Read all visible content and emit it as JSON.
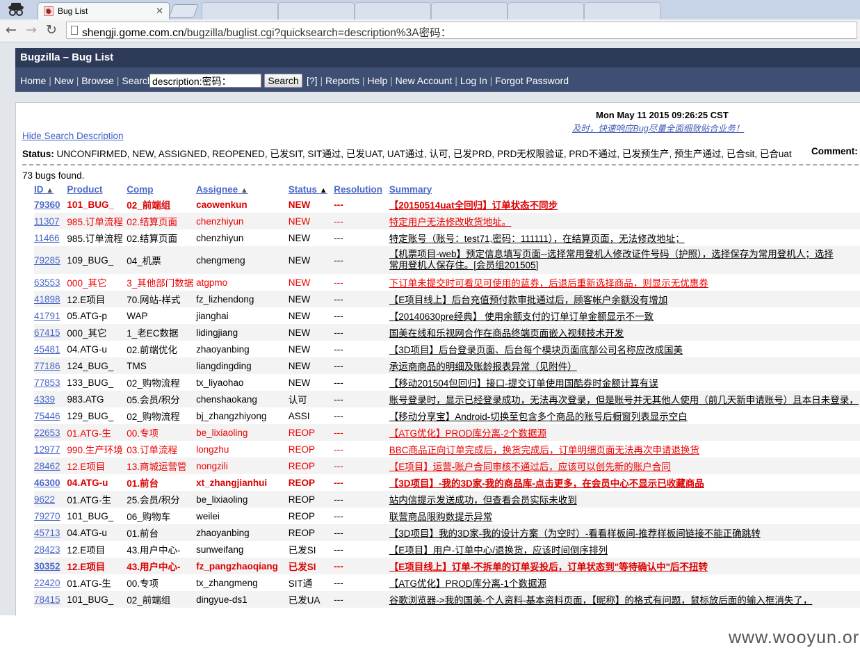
{
  "browser": {
    "active_tab_title": "Bug List",
    "url_host": "shengji.gome.com.cn",
    "url_path": "/bugzilla/buglist.cgi?quicksearch=description%3A密码："
  },
  "header": {
    "title": "Bugzilla – Bug List"
  },
  "nav": {
    "home": "Home",
    "new": "New",
    "browse": "Browse",
    "search": "Search",
    "quicksearch_value": "description:密码：",
    "search_button": "Search",
    "help_q": "[?]",
    "reports": "Reports",
    "help": "Help",
    "new_account": "New Account",
    "log_in": "Log In",
    "forgot_password": "Forgot Password"
  },
  "info": {
    "date": "Mon May 11 2015 09:26:25 CST",
    "motto": "及时，快速响应Bug尽量全面细致贴合业务！",
    "hide_search": "Hide Search Description",
    "status_label": "Status:",
    "status_value": "UNCONFIRMED, NEW, ASSIGNED, REOPENED, 已发SIT, SIT通过, 已发UAT, UAT通过, 认可, 已发PRD, PRD无权限验证, PRD不通过, 已发预生产, 预生产通过, 已合sit, 已合uat",
    "comment_label": "Comment:",
    "bugs_found": "73 bugs found."
  },
  "columns": [
    "ID",
    "Product",
    "Comp",
    "Assignee",
    "Status",
    "Resolution",
    "Summary"
  ],
  "bugs": [
    {
      "id": "79360",
      "product": "101_BUG_",
      "comp": "02_前端组",
      "assignee": "caowenkun",
      "status": "NEW",
      "res": "---",
      "summary": "【20150514uat全回归】订单状态不同步",
      "style": "crit"
    },
    {
      "id": "11307",
      "product": "985.订单流程",
      "comp": "02.结算页面",
      "assignee": "chenzhiyun",
      "status": "NEW",
      "res": "---",
      "summary": "特定用户无法修改收货地址。",
      "style": "red"
    },
    {
      "id": "11466",
      "product": "985.订单流程",
      "comp": "02.结算页面",
      "assignee": "chenzhiyun",
      "status": "NEW",
      "res": "---",
      "summary": "特定账号（账号：test71,密码：111111），在结算页面，无法修改地址；",
      "style": ""
    },
    {
      "id": "79285",
      "product": "109_BUG_",
      "comp": "04_机票",
      "assignee": "chengmeng",
      "status": "NEW",
      "res": "---",
      "summary": "【机票项目-web】预定信息填写页面--选择常用登机人修改证件号码（护照），选择保存为常用登机人；选择常用登机人保存住。[会员组201505]",
      "style": "",
      "tall": true
    },
    {
      "id": "63553",
      "product": "000_其它",
      "comp": "3_其他部门数据",
      "assignee": "atgpmo",
      "status": "NEW",
      "res": "---",
      "summary": "下订单未提交时可看见可使用的蓝券，后退后重新选择商品，则显示无优惠券",
      "style": "red"
    },
    {
      "id": "41898",
      "product": "12.E项目",
      "comp": "70.网站-样式",
      "assignee": "fz_lizhendong",
      "status": "NEW",
      "res": "---",
      "summary": "【E项目线上】后台充值预付款审批通过后，顾客帐户余额没有增加",
      "style": ""
    },
    {
      "id": "41791",
      "product": "05.ATG-p",
      "comp": "WAP",
      "assignee": "jianghai",
      "status": "NEW",
      "res": "---",
      "summary": "【20140630pre经典】 使用余额支付的订单订单金额显示不一致",
      "style": ""
    },
    {
      "id": "67415",
      "product": "000_其它",
      "comp": "1_老EC数据",
      "assignee": "lidingjiang",
      "status": "NEW",
      "res": "---",
      "summary": "国美在线和乐视网合作在商品终端页面嵌入视频技术开发",
      "style": ""
    },
    {
      "id": "45481",
      "product": "04.ATG-u",
      "comp": "02.前端优化",
      "assignee": "zhaoyanbing",
      "status": "NEW",
      "res": "---",
      "summary": "【3D项目】后台登录页面、后台每个模块页面底部公司名称应改成国美",
      "style": ""
    },
    {
      "id": "77186",
      "product": "124_BUG_",
      "comp": "TMS",
      "assignee": "liangdingding",
      "status": "NEW",
      "res": "---",
      "summary": "承运商商品的明细及账龄报表异常（见附件）",
      "style": ""
    },
    {
      "id": "77853",
      "product": "133_BUG_",
      "comp": "02_购物流程",
      "assignee": "tx_liyaohao",
      "status": "NEW",
      "res": "---",
      "summary": "【移动201504包回归】接口-提交订单使用国酷券时金额计算有误",
      "style": ""
    },
    {
      "id": "4339",
      "product": "983.ATG",
      "comp": "05.会员/积分",
      "assignee": "chenshaokang",
      "status": "认可",
      "res": "---",
      "summary": "账号登录时，显示已经登录成功，无法再次登录，但是账号并无其他人使用（前几天新申请账号）且本日未登录，",
      "style": ""
    },
    {
      "id": "75446",
      "product": "129_BUG_",
      "comp": "02_购物流程",
      "assignee": "bj_zhangzhiyong",
      "status": "ASSI",
      "res": "---",
      "summary": "【移动分享宝】Android-切换至包含多个商品的账号后橱窗列表显示空白",
      "style": ""
    },
    {
      "id": "22653",
      "product": "01.ATG-生",
      "comp": "00.专项",
      "assignee": "be_lixiaoling",
      "status": "REOP",
      "res": "---",
      "summary": "【ATG优化】PROD库分离-2个数据源",
      "style": "red"
    },
    {
      "id": "12977",
      "product": "990.生产环境",
      "comp": "03.订单流程",
      "assignee": "longzhu",
      "status": "REOP",
      "res": "---",
      "summary": "BBC商品正向订单完成后，换货完成后，订单明细页面无法再次申请退换货",
      "style": "red"
    },
    {
      "id": "28462",
      "product": "12.E项目",
      "comp": "13.商城运营管",
      "assignee": "nongzili",
      "status": "REOP",
      "res": "---",
      "summary": "【E项目】运营-账户合同审核不通过后，应该可以创先新的账户合同",
      "style": "red"
    },
    {
      "id": "46300",
      "product": "04.ATG-u",
      "comp": "01.前台",
      "assignee": "xt_zhangjianhui",
      "status": "REOP",
      "res": "---",
      "summary": "【3D项目】-我的3D家-我的商品库-点击更多，在会员中心不显示已收藏商品",
      "style": "crit"
    },
    {
      "id": "9622",
      "product": "01.ATG-生",
      "comp": "25.会员/积分",
      "assignee": "be_lixiaoling",
      "status": "REOP",
      "res": "---",
      "summary": "站内信提示发送成功，但查看会员实际未收到",
      "style": ""
    },
    {
      "id": "79270",
      "product": "101_BUG_",
      "comp": "06_购物车",
      "assignee": "weilei",
      "status": "REOP",
      "res": "---",
      "summary": "联营商品限购数提示异常",
      "style": ""
    },
    {
      "id": "45713",
      "product": "04.ATG-u",
      "comp": "01.前台",
      "assignee": "zhaoyanbing",
      "status": "REOP",
      "res": "---",
      "summary": "【3D项目】我的3D家-我的设计方案（为空时）-看看样板间-推荐样板间链接不能正确跳转",
      "style": ""
    },
    {
      "id": "28423",
      "product": "12.E项目",
      "comp": "43.用户中心-",
      "assignee": "sunweifang",
      "status": "已发SI",
      "res": "---",
      "summary": "【E项目】用户-订单中心/退换货，应该时间倒序排列",
      "style": ""
    },
    {
      "id": "30352",
      "product": "12.E项目",
      "comp": "43.用户中心-",
      "assignee": "fz_pangzhaoqiang",
      "status": "已发SI",
      "res": "---",
      "summary": "【E项目线上】订单-不拆单的订单妥投后，订单状态到\"等待确认中\"后不扭转",
      "style": "crit"
    },
    {
      "id": "22420",
      "product": "01.ATG-生",
      "comp": "00.专项",
      "assignee": "tx_zhangmeng",
      "status": "SIT通",
      "res": "---",
      "summary": "【ATG优化】PROD库分离-1个数据源",
      "style": ""
    },
    {
      "id": "78415",
      "product": "101_BUG_",
      "comp": "02_前端组",
      "assignee": "dingyue-ds1",
      "status": "已发UA",
      "res": "---",
      "summary": "谷歌浏览器->我的国美-个人资料-基本资料页面，【昵称】的格式有问题，鼠标放后面的输入框消失了，",
      "style": ""
    }
  ],
  "watermark": "www.wooyun.org"
}
